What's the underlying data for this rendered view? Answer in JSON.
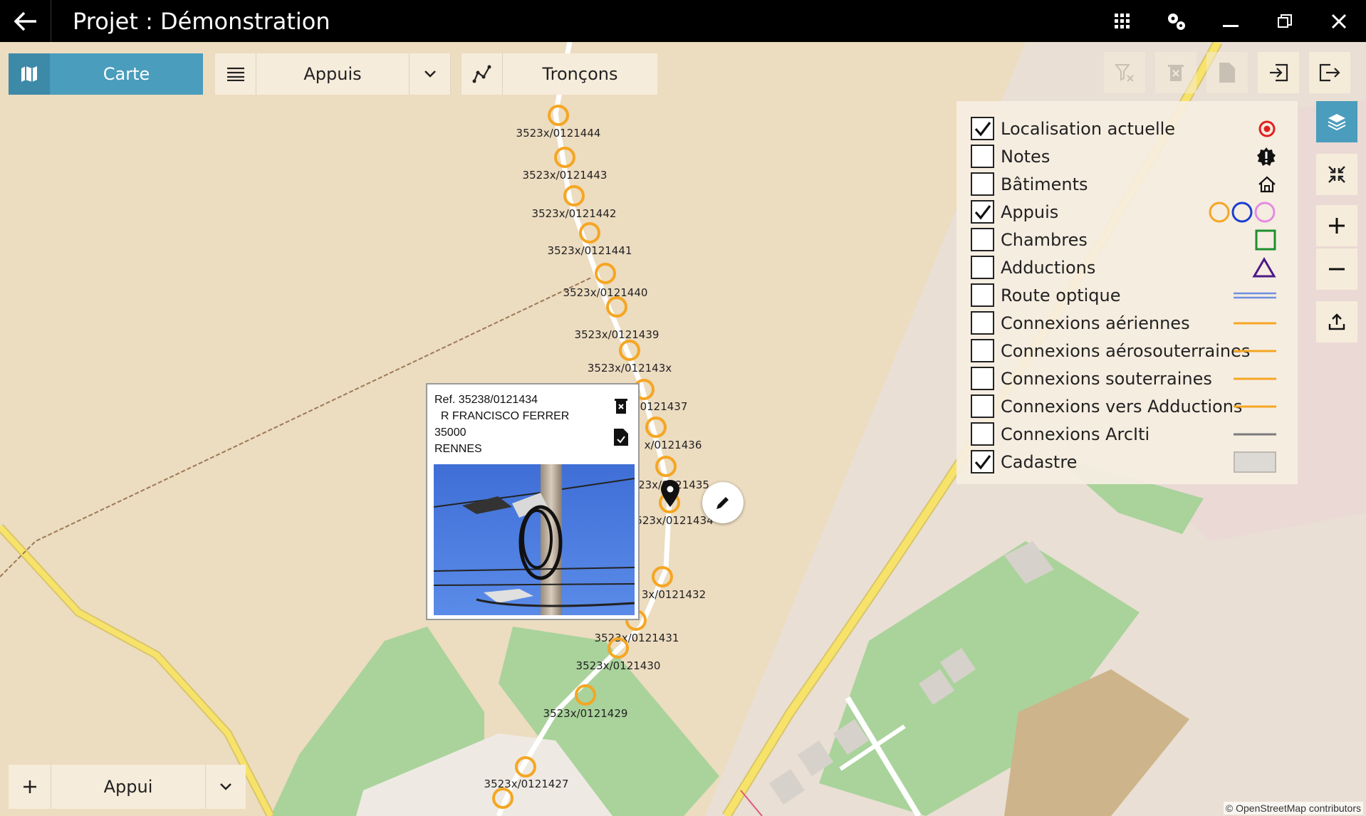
{
  "window": {
    "title": "Projet : Démonstration"
  },
  "toolbar": {
    "carte_label": "Carte",
    "appuis_label": "Appuis",
    "troncons_label": "Tronçons"
  },
  "legend": {
    "items": [
      {
        "label": "Localisation actuelle",
        "checked": true,
        "icon": "target-icon"
      },
      {
        "label": "Notes",
        "checked": false,
        "icon": "alert-badge-icon"
      },
      {
        "label": "Bâtiments",
        "checked": false,
        "icon": "home-icon"
      },
      {
        "label": "Appuis",
        "checked": true,
        "icon": "circles-icon"
      },
      {
        "label": "Chambres",
        "checked": false,
        "icon": "green-square-icon"
      },
      {
        "label": "Adductions",
        "checked": false,
        "icon": "purple-triangle-icon"
      },
      {
        "label": "Route optique",
        "checked": false,
        "icon": "blue-double-line-icon"
      },
      {
        "label": "Connexions aériennes",
        "checked": false,
        "icon": "orange-line-icon"
      },
      {
        "label": "Connexions aérosouterraines",
        "checked": false,
        "icon": "orange-line-icon"
      },
      {
        "label": "Connexions souterraines",
        "checked": false,
        "icon": "orange-line-icon"
      },
      {
        "label": "Connexions vers Adductions",
        "checked": false,
        "icon": "orange-line-icon"
      },
      {
        "label": "Connexions ArcIti",
        "checked": false,
        "icon": "gray-line-icon"
      },
      {
        "label": "Cadastre",
        "checked": true,
        "icon": "gray-rect-icon"
      }
    ]
  },
  "colors": {
    "accent": "#4a9dbc",
    "appui_circle": "#f5a623",
    "map_bg": "#ecdcc0",
    "road_yellow": "#f7e36a",
    "park_green": "#a9d39b"
  },
  "markers": [
    {
      "label": "3523x/0121444"
    },
    {
      "label": "3523x/0121443"
    },
    {
      "label": "3523x/0121442"
    },
    {
      "label": "3523x/0121441"
    },
    {
      "label": "3523x/0121440"
    },
    {
      "label": "3523x/0121439"
    },
    {
      "label": "3523x/012143x"
    },
    {
      "label": "0121437"
    },
    {
      "label": "x/0121436"
    },
    {
      "label": "23x/0121435"
    },
    {
      "label": "523x/0121434"
    },
    {
      "label": "3x/0121432"
    },
    {
      "label": "3523x/0121431"
    },
    {
      "label": "3523x/0121430"
    },
    {
      "label": "3523x/0121429"
    },
    {
      "label": "3523x/0121427"
    }
  ],
  "popup": {
    "ref": "Ref. 35238/0121434",
    "street": "  R FRANCISCO FERRER",
    "postcode": "35000",
    "city": "RENNES"
  },
  "bottom": {
    "add_label": "Appui"
  },
  "attribution": "© OpenStreetMap contributors"
}
